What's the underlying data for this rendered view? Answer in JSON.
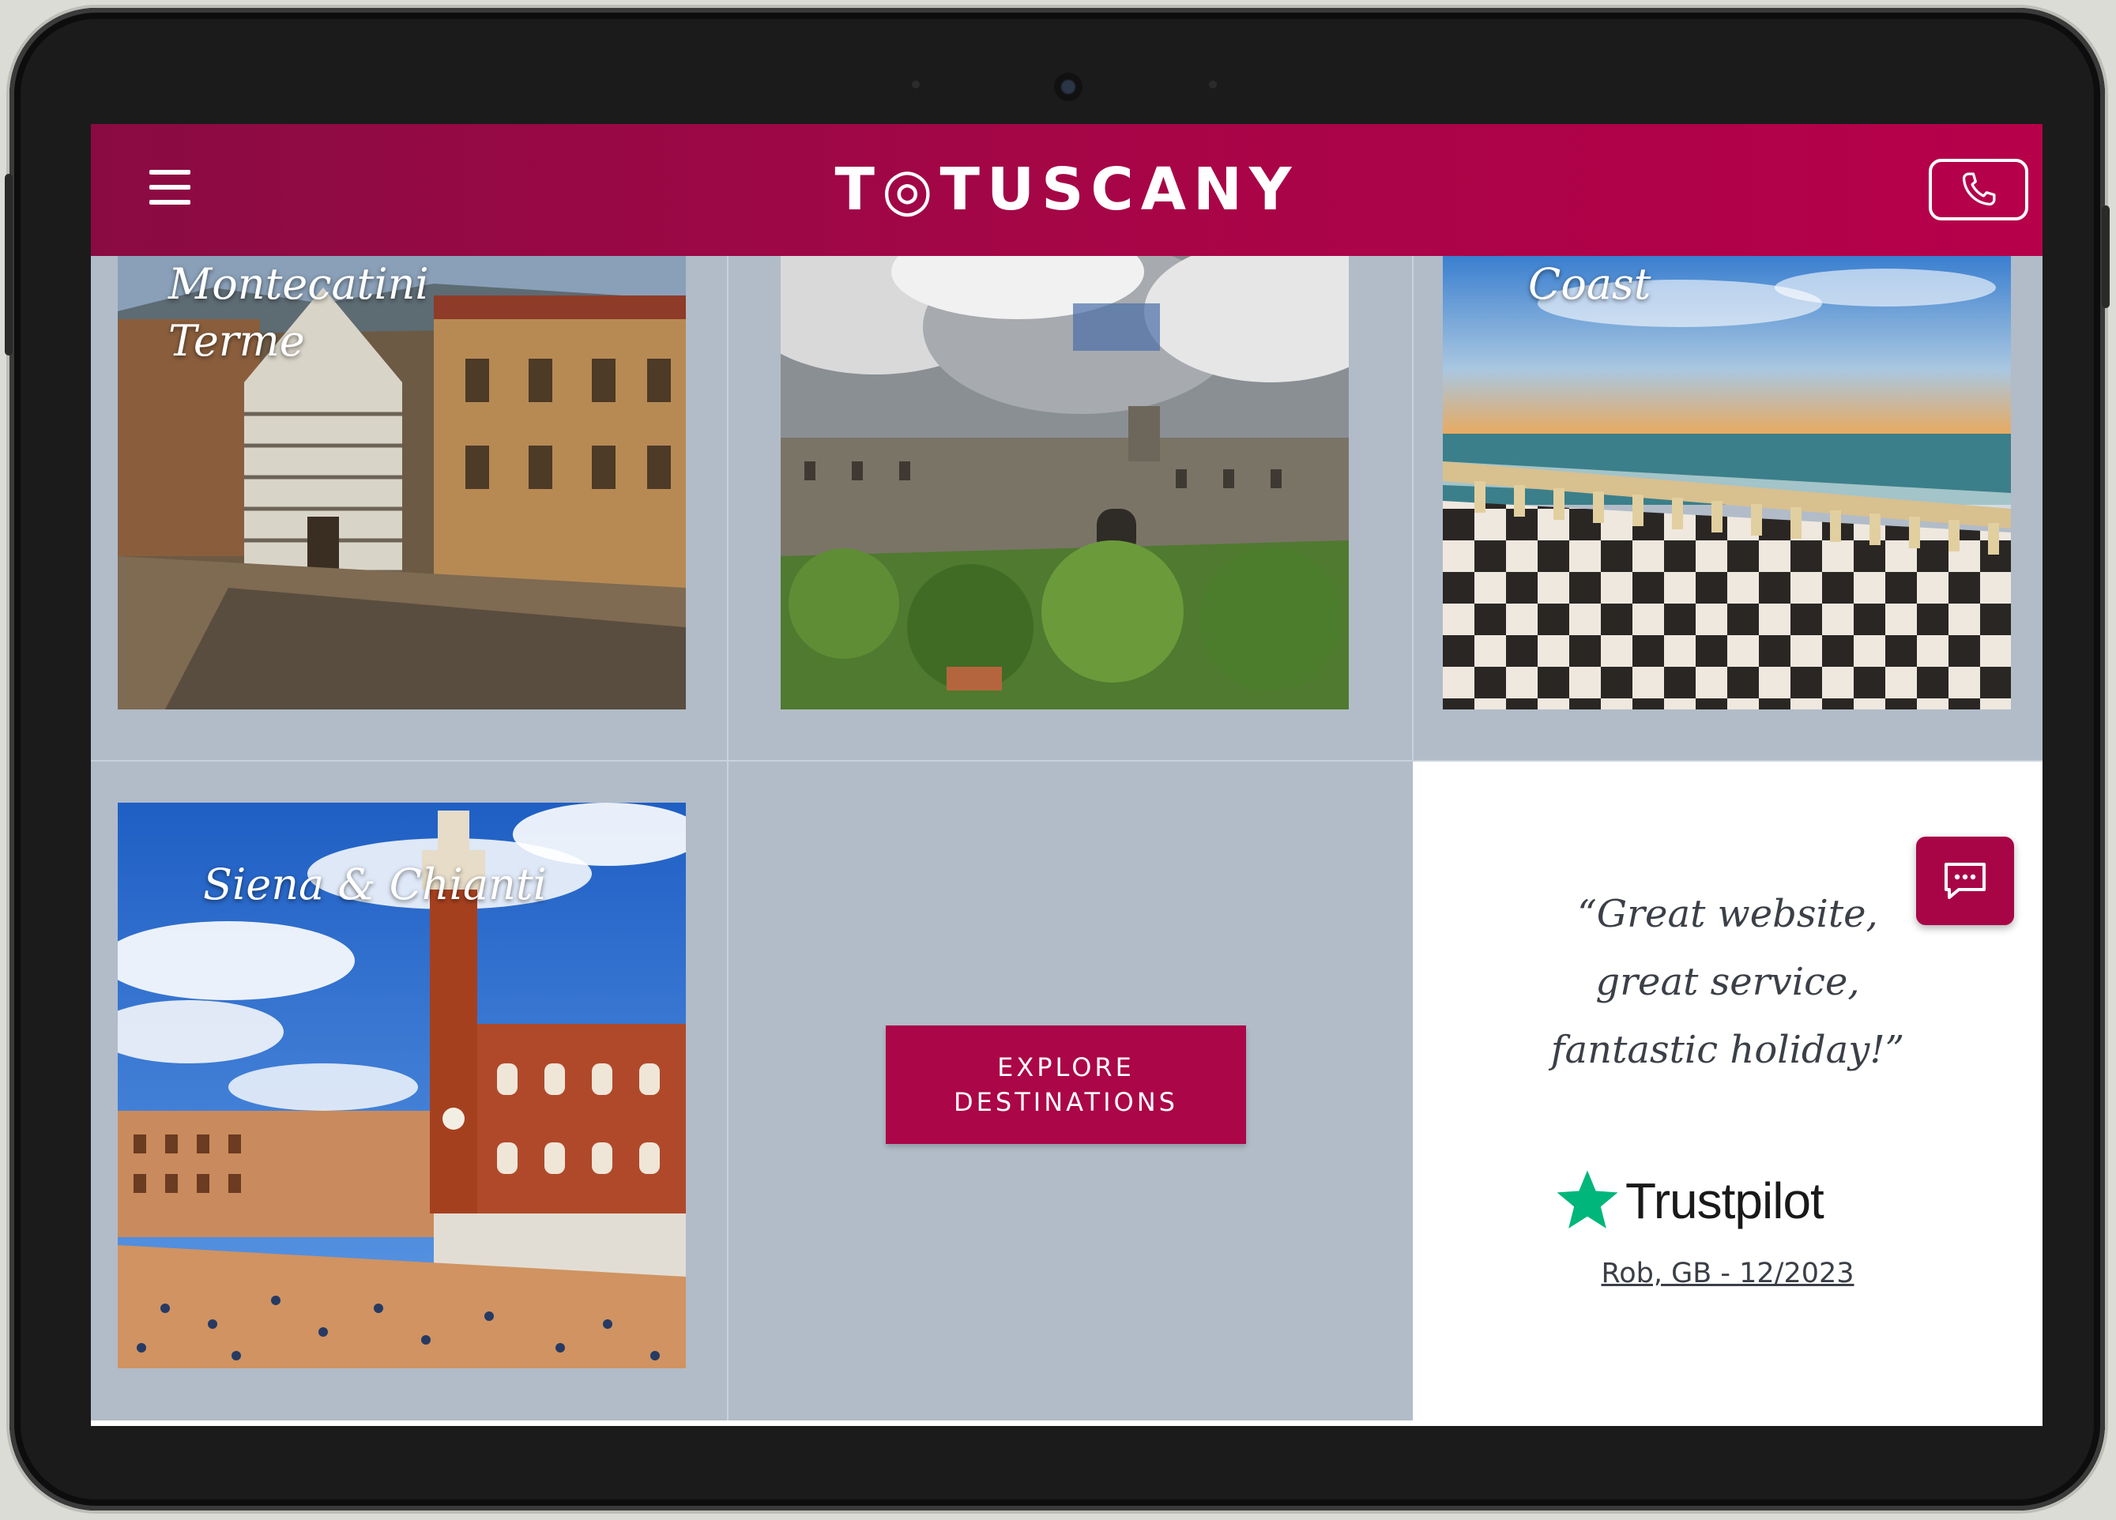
{
  "header": {
    "menu_icon": "hamburger-icon",
    "logo_text": "T◎TUSCANY",
    "phone_icon": "phone-icon",
    "brand_color": "#ab0647"
  },
  "tiles": [
    {
      "label": "Montecatini Terme"
    },
    {
      "label": ""
    },
    {
      "label": "Coast"
    },
    {
      "label": "Siena & Chianti"
    }
  ],
  "explore_button": {
    "line1": "EXPLORE",
    "line2": "DESTINATIONS"
  },
  "review": {
    "quote_line1": "“Great website,",
    "quote_line2": "great service,",
    "quote_line3": "fantastic holiday!”",
    "provider": "Trustpilot",
    "provider_icon": "star-icon",
    "reviewer": "Rob, GB - 12/2023"
  },
  "chat": {
    "icon": "chat-icon"
  }
}
